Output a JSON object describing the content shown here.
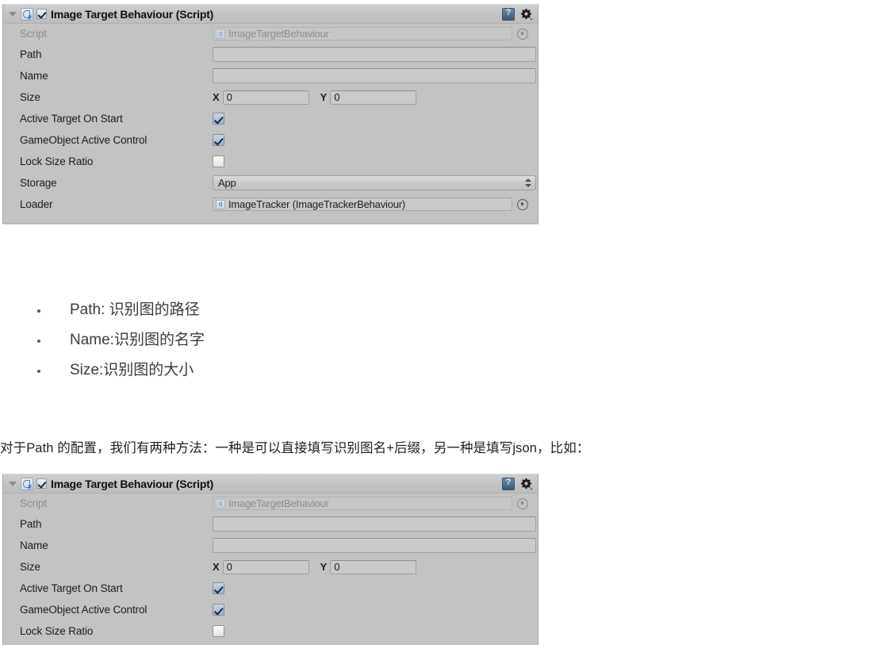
{
  "page": {
    "background": "#ffffff",
    "panel_background": "#c3c3c3",
    "accent_blue": "#4a86c4"
  },
  "inspector": {
    "header": {
      "title": "Image Target Behaviour (Script)",
      "enabled_checkbox": true,
      "foldout_expanded": true,
      "icons": {
        "foldout": "triangle-down-icon",
        "script": "csharp-script-icon",
        "help": "help-book-icon",
        "preset": "gear-icon"
      }
    },
    "rows": [
      {
        "label": "Script",
        "type": "object",
        "value": "ImageTargetBehaviour",
        "disabled": true
      },
      {
        "label": "Path",
        "type": "text",
        "value": "",
        "placeholder": ""
      },
      {
        "label": "Name",
        "type": "text",
        "value": "",
        "placeholder": ""
      },
      {
        "label": "Size",
        "type": "vector2",
        "x_label": "X",
        "x_value": "0",
        "y_label": "Y",
        "y_value": "0"
      },
      {
        "label": "Active Target On Start",
        "type": "checkbox",
        "checked": true
      },
      {
        "label": "GameObject Active Control",
        "type": "checkbox",
        "checked": true
      },
      {
        "label": "Lock Size Ratio",
        "type": "checkbox",
        "checked": false
      },
      {
        "label": "Storage",
        "type": "popup",
        "value": "App"
      },
      {
        "label": "Loader",
        "type": "object",
        "value": "ImageTracker (ImageTrackerBehaviour)",
        "disabled": false
      }
    ]
  },
  "article": {
    "bullets": [
      "Path: 识别图的路径",
      "Name:识别图的名字",
      "Size:识别图的大小"
    ],
    "paragraph": "对于Path 的配置，我们有两种方法：一种是可以直接填写识别图名+后缀，另一种是填写json，比如："
  }
}
